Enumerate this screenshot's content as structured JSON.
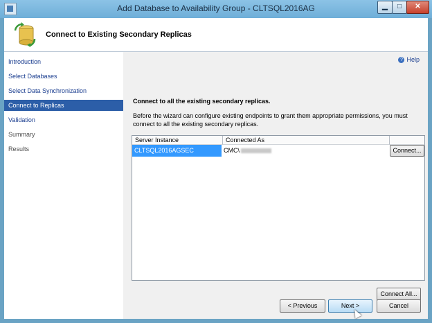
{
  "window": {
    "title": "Add Database to Availability Group - CLTSQL2016AG"
  },
  "header": {
    "title": "Connect to Existing Secondary Replicas"
  },
  "nav": {
    "items": [
      {
        "label": "Introduction"
      },
      {
        "label": "Select Databases"
      },
      {
        "label": "Select Data Synchronization"
      },
      {
        "label": "Connect to Replicas",
        "selected": true
      },
      {
        "label": "Validation"
      },
      {
        "label": "Summary"
      },
      {
        "label": "Results"
      }
    ]
  },
  "content": {
    "help": "Help",
    "heading": "Connect to all the existing secondary replicas.",
    "description": "Before the wizard can configure existing endpoints to grant them appropriate permissions, you must connect to all the existing secondary replicas."
  },
  "grid": {
    "columns": [
      "Server Instance",
      "Connected As"
    ],
    "rows": [
      {
        "server": "CLTSQL2016AGSEC",
        "connected_as": "CMC\\",
        "button": "Connect..."
      }
    ]
  },
  "buttons": {
    "connect_all": "Connect All...",
    "previous": "< Previous",
    "next": "Next >",
    "cancel": "Cancel"
  },
  "colors": {
    "selection": "#2c5ea8",
    "grid_selection": "#3399ff",
    "title_bar": "#6eaed8"
  },
  "icons": [
    "app-icon",
    "database-wizard-icon",
    "help-icon",
    "mouse-cursor-icon"
  ]
}
